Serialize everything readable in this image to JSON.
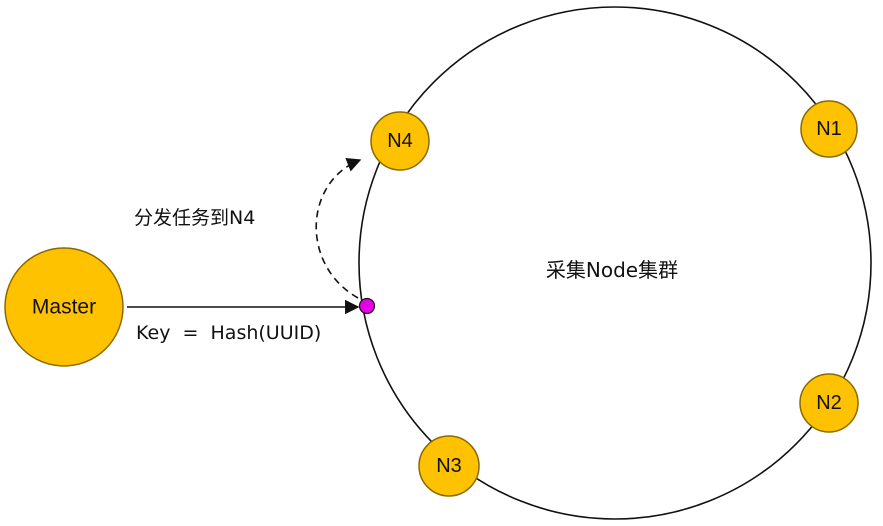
{
  "ring": {
    "label": "采集Node集群"
  },
  "master": {
    "label": "Master"
  },
  "nodes": [
    {
      "id": "n1",
      "label": "N1"
    },
    {
      "id": "n2",
      "label": "N2"
    },
    {
      "id": "n3",
      "label": "N3"
    },
    {
      "id": "n4",
      "label": "N4"
    }
  ],
  "edges": {
    "hash_label": "Key  =  Hash(UUID)",
    "dispatch_label": "分发任务到N4"
  },
  "colors": {
    "node_fill": "#FFC200",
    "node_stroke": "#8A6A00",
    "key_point_fill": "#E600E6",
    "line": "#111111"
  }
}
